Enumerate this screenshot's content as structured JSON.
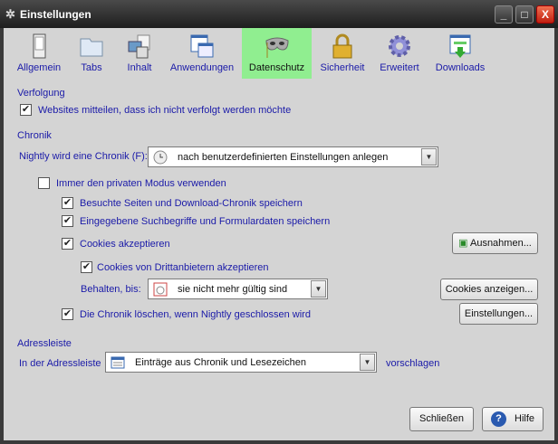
{
  "window": {
    "title": "Einstellungen",
    "minimize": "_",
    "maximize": "□",
    "close": "X"
  },
  "toolbar": [
    {
      "label": "Allgemein",
      "icon": "switch-icon"
    },
    {
      "label": "Tabs",
      "icon": "folder-icon"
    },
    {
      "label": "Inhalt",
      "icon": "content-icon"
    },
    {
      "label": "Anwendungen",
      "icon": "applications-icon"
    },
    {
      "label": "Datenschutz",
      "icon": "mask-icon",
      "selected": true
    },
    {
      "label": "Sicherheit",
      "icon": "lock-icon"
    },
    {
      "label": "Erweitert",
      "icon": "gear-icon"
    },
    {
      "label": "Downloads",
      "icon": "download-icon"
    }
  ],
  "tracking": {
    "heading": "Verfolgung",
    "dnt_label": "Websites mitteilen, dass ich nicht verfolgt werden möchte",
    "dnt_checked": true
  },
  "history": {
    "heading": "Chronik",
    "mode_label": "Nightly wird eine Chronik (F):",
    "mode_value": "nach benutzerdefinierten Einstellungen anlegen",
    "private_label": "Immer den privaten Modus verwenden",
    "private_checked": false,
    "visited_label": "Besuchte Seiten und Download-Chronik speichern",
    "visited_checked": true,
    "forms_label": "Eingegebene Suchbegriffe und Formulardaten speichern",
    "forms_checked": true,
    "cookies_label": "Cookies akzeptieren",
    "cookies_checked": true,
    "exceptions_button": "Ausnahmen...",
    "thirdparty_label": "Cookies von Drittanbietern akzeptieren",
    "thirdparty_checked": true,
    "keep_label": "Behalten, bis:",
    "keep_value": "sie nicht mehr gültig sind",
    "show_cookies_button": "Cookies anzeigen...",
    "clear_label": "Die Chronik löschen, wenn Nightly geschlossen wird",
    "clear_checked": true,
    "settings_button": "Einstellungen..."
  },
  "location": {
    "heading": "Adressleiste",
    "label": "In der Adressleiste",
    "value": "Einträge aus Chronik und Lesezeichen",
    "suffix": "vorschlagen"
  },
  "footer": {
    "close_button": "Schließen",
    "help_button": "Hilfe"
  },
  "colors": {
    "text": "#1a1aa8",
    "selected_tab": "#90ee90",
    "background": "#d4d4d4"
  }
}
